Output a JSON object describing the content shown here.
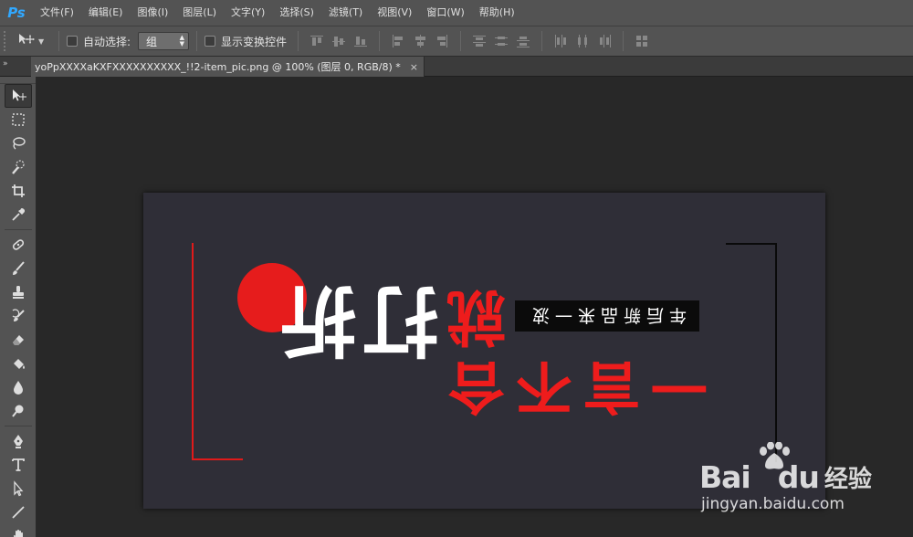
{
  "app": {
    "logo": "Ps"
  },
  "menu": [
    "文件(F)",
    "编辑(E)",
    "图像(I)",
    "图层(L)",
    "文字(Y)",
    "选择(S)",
    "滤镜(T)",
    "视图(V)",
    "窗口(W)",
    "帮助(H)"
  ],
  "options": {
    "tool_glyph": "move-tool-icon",
    "auto_select_label": "自动选择:",
    "auto_select_checked": false,
    "auto_select_value": "组",
    "show_transform_label": "显示变换控件",
    "show_transform_checked": false
  },
  "panel_collapse": "»",
  "document_tab": {
    "title": "yoPpXXXXaKXFXXXXXXXXXX_!!2-item_pic.png @ 100% (图层 0, RGB/8) *",
    "close": "×"
  },
  "tools": [
    "move-tool",
    "rectangular-marquee",
    "lasso",
    "quick-selection",
    "crop",
    "eyedropper",
    "spot-healing",
    "brush",
    "clone-stamp",
    "history-brush",
    "eraser",
    "paint-bucket",
    "blur",
    "dodge",
    "pen",
    "type",
    "path-selection",
    "line",
    "hand"
  ],
  "canvas": {
    "title_white": "打折",
    "title_red_1": "就",
    "title_red_2": "一言不合",
    "tag": "年后新品来一波",
    "colors": {
      "background": "#2f2e37",
      "red": "#ee1c1c",
      "white": "#ffffff",
      "black": "#0b0b0b"
    }
  },
  "watermark": {
    "brand": "Bai",
    "brand2": "du",
    "brand_cn": "经验",
    "url": "jingyan.baidu.com"
  }
}
